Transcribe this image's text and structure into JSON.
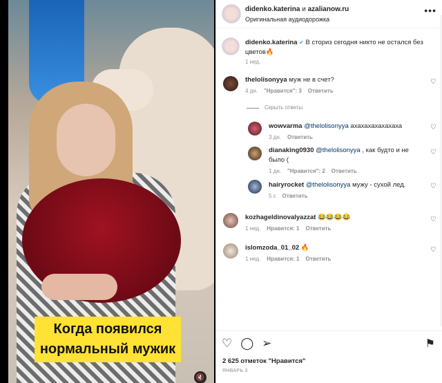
{
  "video": {
    "caption_line1": "Когда появился",
    "caption_line2": "нормальный мужик",
    "mute_icon": "speaker-muted-icon"
  },
  "header": {
    "user1": "didenko.katerina",
    "and": " и ",
    "user2": "azalianow.ru",
    "audio": "Оригинальная аудиодорожка"
  },
  "caption": {
    "user": "didenko.katerina",
    "verified": "✔",
    "text": " В сториз сегодня никто не остался без цветов🔥",
    "time": "1 нед."
  },
  "comments": [
    {
      "user": "thelolisonyya",
      "text": " муж не в счет?",
      "time": "4 дн.",
      "likes": "\"Нравится\": 3",
      "reply": "Ответить"
    },
    {
      "user": "wowvarma",
      "mention": " @thelolisonyya",
      "text": " ахахахахахахаха",
      "time": "3 дн.",
      "reply": "Ответить"
    },
    {
      "user": "dianaking0930",
      "mention": " @thelolisonyya",
      "text": " , как будто и не было (",
      "time": "1 дн.",
      "likes": "\"Нравится\": 2",
      "reply": "Ответить"
    },
    {
      "user": "hairyrocket",
      "mention": " @thelolisonyya",
      "text": " мужу - сухой лед.",
      "time": "5 с",
      "reply": "Ответить"
    },
    {
      "user": "kozhageldinovalyazzat",
      "text": " 😂😂😂😂",
      "time": "1 нед.",
      "likes": "Нравится: 1",
      "reply": "Ответить"
    },
    {
      "user": "islomzoda_01_02",
      "text": " 🔥",
      "time": "1 нед.",
      "likes": "Нравится: 1",
      "reply": "Ответить"
    }
  ],
  "hide_replies": "Скрыть ответы",
  "likes_text": "2 625 отметок \"Нравится\"",
  "date_text": "ЯНВАРЬ 3"
}
